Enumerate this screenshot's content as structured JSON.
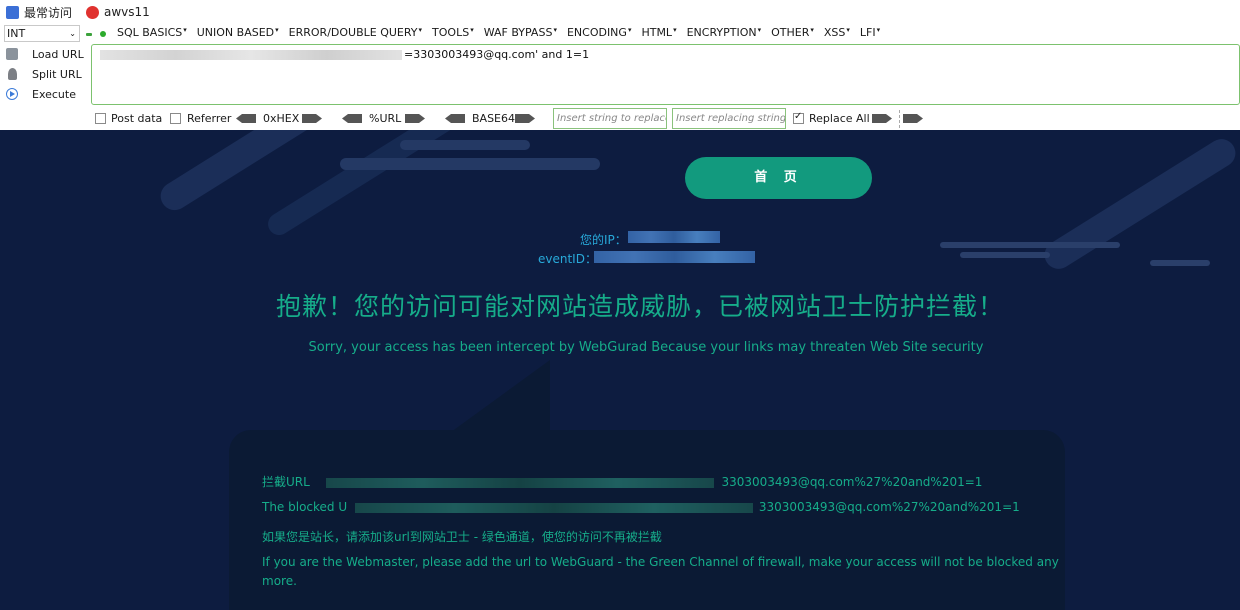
{
  "bookmarks": [
    {
      "label": "最常访问",
      "icon": "folder-icon"
    },
    {
      "label": "awvs11",
      "icon": "awvs-icon"
    }
  ],
  "hackbar": {
    "select_value": "INT",
    "menu": [
      "SQL BASICS",
      "UNION BASED",
      "ERROR/DOUBLE QUERY",
      "TOOLS",
      "WAF BYPASS",
      "ENCODING",
      "HTML",
      "ENCRYPTION",
      "OTHER",
      "XSS",
      "LFI"
    ],
    "side_buttons": {
      "load": "Load URL",
      "split": "Split URL",
      "execute": "Execute"
    },
    "url_visible_text": "=3303003493@qq.com' and 1=1",
    "post_data": "Post data",
    "referrer": "Referrer",
    "hex": "0xHEX",
    "url_enc": "%URL",
    "base64": "BASE64",
    "replace_placeholder": "Insert string to replace",
    "replacing_placeholder": "Insert replacing string",
    "replace_all": "Replace All"
  },
  "page": {
    "home_button": "首 页",
    "ip_label": "您的IP：",
    "event_label": "eventID：",
    "title_cn": "抱歉！您的访问可能对网站造成威胁，已被网站卫士防护拦截！",
    "title_en": "Sorry, your access has been intercept by WebGurad Because your links may threaten Web Site security",
    "blocked_cn_label": "拦截URL",
    "blocked_cn_tail": "3303003493@qq.com%27%20and%201=1",
    "blocked_en_label": "The blocked U",
    "blocked_en_tail": "3303003493@qq.com%27%20and%201=1",
    "webmaster_cn": "如果您是站长，请添加该url到网站卫士 - 绿色通道，使您的访问不再被拦截",
    "webmaster_en_1": "If you are the Webmaster, please add the url to WebGuard - the Green Channel of firewall, make your access will not be blocked any",
    "webmaster_en_2": "more."
  },
  "colors": {
    "page_bg": "#0d1c40",
    "accent_green": "#16ad8a",
    "button_green": "#129a7e",
    "ip_blue": "#28a9d9"
  }
}
